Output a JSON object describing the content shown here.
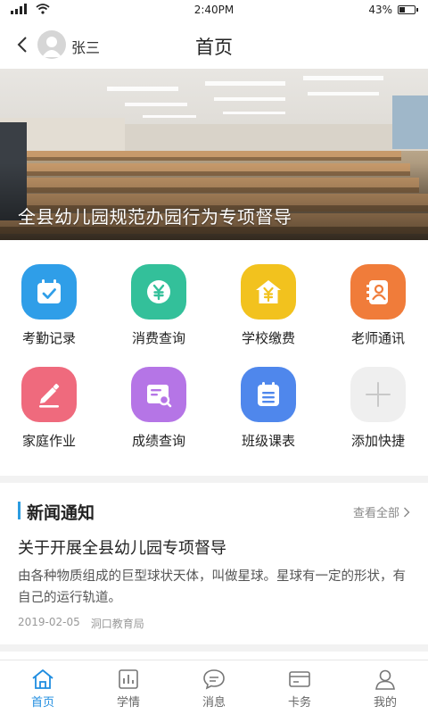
{
  "status_bar": {
    "time": "2:40PM",
    "battery": "43%",
    "battery_level": 0.43
  },
  "nav": {
    "user_name": "张三",
    "title": "首页"
  },
  "banner": {
    "caption": "全县幼儿园规范办园行为专项督导"
  },
  "grid": [
    {
      "label": "考勤记录",
      "icon": "calendar-check-icon",
      "color": "#2f9ee8"
    },
    {
      "label": "消费查询",
      "icon": "yuan-coin-icon",
      "color": "#33c09a"
    },
    {
      "label": "学校缴费",
      "icon": "school-yuan-icon",
      "color": "#f2c21e"
    },
    {
      "label": "老师通讯",
      "icon": "contact-book-icon",
      "color": "#f07c3a"
    },
    {
      "label": "家庭作业",
      "icon": "pencil-icon",
      "color": "#ef6a7d"
    },
    {
      "label": "成绩查询",
      "icon": "report-search-icon",
      "color": "#b575e6"
    },
    {
      "label": "班级课表",
      "icon": "schedule-icon",
      "color": "#4f87ec"
    },
    {
      "label": "添加快捷",
      "icon": "plus-icon",
      "color": "#efefef"
    }
  ],
  "news": {
    "section_title": "新闻通知",
    "more_label": "查看全部",
    "article": {
      "title": "关于开展全县幼儿园专项督导",
      "summary": "由各种物质组成的巨型球状天体，叫做星球。星球有一定的形状，有自己的运行轨道。",
      "date": "2019-02-05",
      "source": "洞口教育局"
    }
  },
  "tabs": [
    {
      "label": "首页",
      "icon": "home-icon",
      "active": true
    },
    {
      "label": "学情",
      "icon": "bar-chart-icon",
      "active": false
    },
    {
      "label": "消息",
      "icon": "chat-bubble-icon",
      "active": false
    },
    {
      "label": "卡务",
      "icon": "card-icon",
      "active": false
    },
    {
      "label": "我的",
      "icon": "user-icon",
      "active": false
    }
  ],
  "colors": {
    "accent": "#1f8de0",
    "news_bar": "#2c9ce0"
  }
}
